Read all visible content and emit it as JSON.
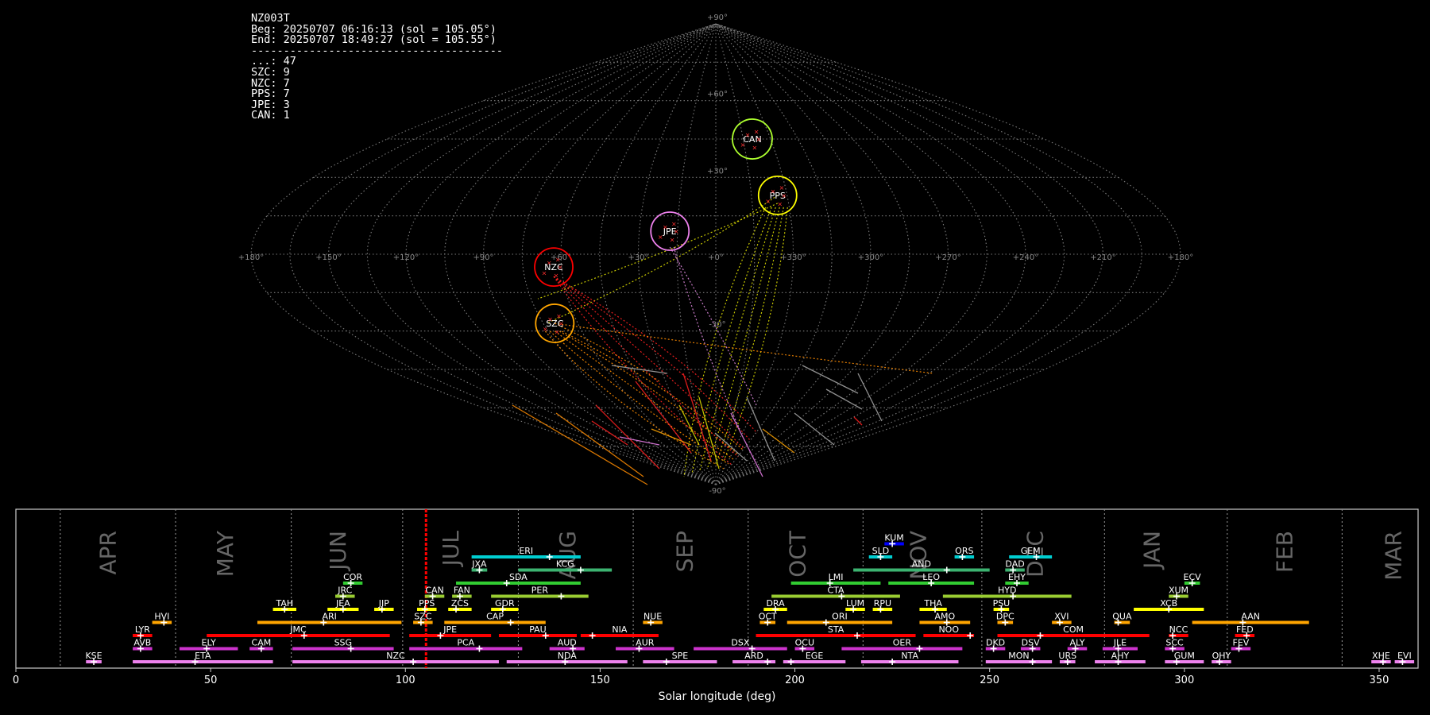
{
  "info": {
    "station": "NZ003T",
    "begin": "Beg: 20250707 06:16:13 (sol = 105.05°)",
    "end": "End: 20250707 18:49:27 (sol = 105.55°)",
    "separator": "---------------------------------------",
    "counts": [
      {
        "code": "...",
        "count": 47
      },
      {
        "code": "SZC",
        "count": 9
      },
      {
        "code": "NZC",
        "count": 7
      },
      {
        "code": "PPS",
        "count": 7
      },
      {
        "code": "JPE",
        "count": 3
      },
      {
        "code": "CAN",
        "count": 1
      }
    ]
  },
  "sky_map": {
    "projection": "sinusoidal",
    "lon_labels": [
      "+180°",
      "+150°",
      "+120°",
      "+90°",
      "+60°",
      "+30°",
      "+0°",
      "+330°",
      "+300°",
      "+270°",
      "+240°",
      "+210°",
      "+180°"
    ],
    "lat_labels": [
      {
        "lat": 90,
        "text": "+90°"
      },
      {
        "lat": 60,
        "text": "+60°"
      },
      {
        "lat": 30,
        "text": "+30°"
      },
      {
        "lat": -30,
        "text": "-30°"
      },
      {
        "lat": -90,
        "text": "-90°"
      }
    ],
    "radiants": [
      {
        "code": "CAN",
        "lon": 20,
        "lat": 45,
        "rx": 25,
        "ry": 25,
        "color": "#adff2f"
      },
      {
        "code": "PPS",
        "lon": 26,
        "lat": 23,
        "rx": 24,
        "ry": 24,
        "color": "#ffff00"
      },
      {
        "code": "JPE",
        "lon": -18,
        "lat": 9,
        "rx": 24,
        "ry": 24,
        "color": "#ee82ee"
      },
      {
        "code": "NZC",
        "lon": -63,
        "lat": -5,
        "rx": 24,
        "ry": 24,
        "color": "#ff0000"
      },
      {
        "code": "SZC",
        "lon": -70,
        "lat": -27,
        "rx": 24,
        "ry": 24,
        "color": "#ffa500"
      }
    ]
  },
  "chart_data": {
    "type": "timeline",
    "xlabel": "Solar longitude (deg)",
    "xlim": [
      0,
      360
    ],
    "xticks": [
      0,
      50,
      100,
      150,
      200,
      250,
      300,
      350
    ],
    "current_sol": 105.3,
    "months": [
      {
        "name": "APR",
        "start": 11.4,
        "label": 24
      },
      {
        "name": "MAY",
        "start": 41,
        "label": 54
      },
      {
        "name": "JUN",
        "start": 70.7,
        "label": 83
      },
      {
        "name": "JUL",
        "start": 99.3,
        "label": 112
      },
      {
        "name": "AUG",
        "start": 129,
        "label": 142
      },
      {
        "name": "SEP",
        "start": 158.5,
        "label": 172
      },
      {
        "name": "OCT",
        "start": 188,
        "label": 201
      },
      {
        "name": "NOV",
        "start": 217.5,
        "label": 232
      },
      {
        "name": "DEC",
        "start": 248,
        "label": 262
      },
      {
        "name": "JAN",
        "start": 279.5,
        "label": 292
      },
      {
        "name": "FEB",
        "start": 311,
        "label": 326
      },
      {
        "name": "MAR",
        "start": 340.5,
        "label": 354
      }
    ],
    "showers": [
      {
        "code": "KUM",
        "start": 223,
        "end": 228,
        "peak": 225,
        "row": 9,
        "color": "#0000ff"
      },
      {
        "code": "ERI",
        "start": 117,
        "end": 145,
        "peak": 137,
        "row": 8,
        "color": "#00ced1"
      },
      {
        "code": "SLD",
        "start": 219,
        "end": 225,
        "peak": 222,
        "row": 8,
        "color": "#00ced1"
      },
      {
        "code": "ORS",
        "start": 241,
        "end": 246,
        "peak": 243,
        "row": 8,
        "color": "#00ced1"
      },
      {
        "code": "GEM",
        "start": 255,
        "end": 266,
        "peak": 262,
        "row": 8,
        "color": "#00ced1"
      },
      {
        "code": "JXA",
        "start": 117,
        "end": 121,
        "peak": 119,
        "row": 7,
        "color": "#3cb371"
      },
      {
        "code": "KCG",
        "start": 129,
        "end": 153,
        "peak": 145,
        "row": 7,
        "color": "#3cb371"
      },
      {
        "code": "AND",
        "start": 215,
        "end": 250,
        "peak": 239,
        "row": 7,
        "color": "#3cb371"
      },
      {
        "code": "DAD",
        "start": 254,
        "end": 259,
        "peak": 256,
        "row": 7,
        "color": "#3cb371"
      },
      {
        "code": "COR",
        "start": 84,
        "end": 89,
        "peak": 86,
        "row": 6,
        "color": "#32cd32"
      },
      {
        "code": "SDA",
        "start": 113,
        "end": 145,
        "peak": 126,
        "row": 6,
        "color": "#32cd32"
      },
      {
        "code": "LMI",
        "start": 199,
        "end": 222,
        "peak": 209,
        "row": 6,
        "color": "#32cd32"
      },
      {
        "code": "LEO",
        "start": 224,
        "end": 246,
        "peak": 235,
        "row": 6,
        "color": "#32cd32"
      },
      {
        "code": "EHY",
        "start": 254,
        "end": 260,
        "peak": 257,
        "row": 6,
        "color": "#32cd32"
      },
      {
        "code": "ECV",
        "start": 300,
        "end": 304,
        "peak": 302,
        "row": 6,
        "color": "#32cd32"
      },
      {
        "code": "JRC",
        "start": 82,
        "end": 87,
        "peak": 84,
        "row": 5,
        "color": "#9acd32"
      },
      {
        "code": "CAN",
        "start": 105,
        "end": 110,
        "peak": 107,
        "row": 5,
        "color": "#9acd32"
      },
      {
        "code": "FAN",
        "start": 112,
        "end": 117,
        "peak": 114,
        "row": 5,
        "color": "#9acd32"
      },
      {
        "code": "PER",
        "start": 122,
        "end": 147,
        "peak": 140,
        "row": 5,
        "color": "#9acd32"
      },
      {
        "code": "CTA",
        "start": 194,
        "end": 227,
        "peak": 212,
        "row": 5,
        "color": "#9acd32"
      },
      {
        "code": "HYD",
        "start": 238,
        "end": 271,
        "peak": 256,
        "row": 5,
        "color": "#9acd32"
      },
      {
        "code": "XUM",
        "start": 296,
        "end": 301,
        "peak": 298,
        "row": 5,
        "color": "#9acd32"
      },
      {
        "code": "TAH",
        "start": 66,
        "end": 72,
        "peak": 69,
        "row": 4,
        "color": "#ffff00"
      },
      {
        "code": "JEA",
        "start": 80,
        "end": 88,
        "peak": 84,
        "row": 4,
        "color": "#ffff00"
      },
      {
        "code": "JIP",
        "start": 92,
        "end": 97,
        "peak": 94,
        "row": 4,
        "color": "#ffff00"
      },
      {
        "code": "PPS",
        "start": 103,
        "end": 108,
        "peak": 105,
        "row": 4,
        "color": "#ffff00"
      },
      {
        "code": "ZCS",
        "start": 111,
        "end": 117,
        "peak": 113,
        "row": 4,
        "color": "#ffff00"
      },
      {
        "code": "GDR",
        "start": 122,
        "end": 129,
        "peak": 125,
        "row": 4,
        "color": "#ffff00"
      },
      {
        "code": "DRA",
        "start": 192,
        "end": 198,
        "peak": 195,
        "row": 4,
        "color": "#ffff00"
      },
      {
        "code": "LUM",
        "start": 213,
        "end": 218,
        "peak": 215,
        "row": 4,
        "color": "#ffff00"
      },
      {
        "code": "RPU",
        "start": 220,
        "end": 225,
        "peak": 222,
        "row": 4,
        "color": "#ffff00"
      },
      {
        "code": "THA",
        "start": 232,
        "end": 239,
        "peak": 236,
        "row": 4,
        "color": "#ffff00"
      },
      {
        "code": "PSU",
        "start": 251,
        "end": 255,
        "peak": 253,
        "row": 4,
        "color": "#ffff00"
      },
      {
        "code": "XCB",
        "start": 287,
        "end": 305,
        "peak": 296,
        "row": 4,
        "color": "#ffff00"
      },
      {
        "code": "HVI",
        "start": 35,
        "end": 40,
        "peak": 38,
        "row": 3,
        "color": "#ffa500"
      },
      {
        "code": "ARI",
        "start": 62,
        "end": 99,
        "peak": 79,
        "row": 3,
        "color": "#ffa500"
      },
      {
        "code": "SZC",
        "start": 102,
        "end": 107,
        "peak": 104,
        "row": 3,
        "color": "#ffa500"
      },
      {
        "code": "CAP",
        "start": 110,
        "end": 136,
        "peak": 127,
        "row": 3,
        "color": "#ffa500"
      },
      {
        "code": "NUE",
        "start": 161,
        "end": 166,
        "peak": 163,
        "row": 3,
        "color": "#ffa500"
      },
      {
        "code": "OCT",
        "start": 191,
        "end": 195,
        "peak": 193,
        "row": 3,
        "color": "#ffa500"
      },
      {
        "code": "ORI",
        "start": 198,
        "end": 225,
        "peak": 208,
        "row": 3,
        "color": "#ffa500"
      },
      {
        "code": "AMO",
        "start": 232,
        "end": 245,
        "peak": 239,
        "row": 3,
        "color": "#ffa500"
      },
      {
        "code": "DPC",
        "start": 252,
        "end": 256,
        "peak": 254,
        "row": 3,
        "color": "#ffa500"
      },
      {
        "code": "XVI",
        "start": 266,
        "end": 271,
        "peak": 268,
        "row": 3,
        "color": "#ffa500"
      },
      {
        "code": "QUA",
        "start": 282,
        "end": 286,
        "peak": 283,
        "row": 3,
        "color": "#ffa500"
      },
      {
        "code": "AAN",
        "start": 302,
        "end": 332,
        "peak": 315,
        "row": 3,
        "color": "#ffa500"
      },
      {
        "code": "LYR",
        "start": 30,
        "end": 35,
        "peak": 32,
        "row": 2,
        "color": "#ff0000"
      },
      {
        "code": "JMC",
        "start": 49,
        "end": 96,
        "peak": 74,
        "row": 2,
        "color": "#ff0000"
      },
      {
        "code": "JPE",
        "start": 101,
        "end": 122,
        "peak": 109,
        "row": 2,
        "color": "#ff0000"
      },
      {
        "code": "PAU",
        "start": 124,
        "end": 144,
        "peak": 136,
        "row": 2,
        "color": "#ff0000"
      },
      {
        "code": "NIA",
        "start": 145,
        "end": 165,
        "peak": 148,
        "row": 2,
        "color": "#ff0000"
      },
      {
        "code": "STA",
        "start": 190,
        "end": 231,
        "peak": 216,
        "row": 2,
        "color": "#ff0000"
      },
      {
        "code": "NOO",
        "start": 233,
        "end": 246,
        "peak": 245,
        "row": 2,
        "color": "#ff0000"
      },
      {
        "code": "COM",
        "start": 252,
        "end": 291,
        "peak": 263,
        "row": 2,
        "color": "#ff0000"
      },
      {
        "code": "NCC",
        "start": 296,
        "end": 301,
        "peak": 297,
        "row": 2,
        "color": "#ff0000"
      },
      {
        "code": "FED",
        "start": 313,
        "end": 318,
        "peak": 316,
        "row": 2,
        "color": "#ff0000"
      },
      {
        "code": "AVB",
        "start": 30,
        "end": 35,
        "peak": 32,
        "row": 1,
        "color": "#cc33cc"
      },
      {
        "code": "ELY",
        "start": 42,
        "end": 57,
        "peak": 49,
        "row": 1,
        "color": "#cc33cc"
      },
      {
        "code": "CAM",
        "start": 60,
        "end": 66,
        "peak": 63,
        "row": 1,
        "color": "#cc33cc"
      },
      {
        "code": "SSG",
        "start": 71,
        "end": 97,
        "peak": 86,
        "row": 1,
        "color": "#cc33cc"
      },
      {
        "code": "PCA",
        "start": 101,
        "end": 130,
        "peak": 119,
        "row": 1,
        "color": "#cc33cc"
      },
      {
        "code": "AUD",
        "start": 137,
        "end": 146,
        "peak": 143,
        "row": 1,
        "color": "#cc33cc"
      },
      {
        "code": "AUR",
        "start": 154,
        "end": 169,
        "peak": 160,
        "row": 1,
        "color": "#cc33cc"
      },
      {
        "code": "DSX",
        "start": 174,
        "end": 198,
        "peak": 189,
        "row": 1,
        "color": "#cc33cc"
      },
      {
        "code": "OCU",
        "start": 200,
        "end": 205,
        "peak": 202,
        "row": 1,
        "color": "#cc33cc"
      },
      {
        "code": "OER",
        "start": 212,
        "end": 243,
        "peak": 232,
        "row": 1,
        "color": "#cc33cc"
      },
      {
        "code": "DKD",
        "start": 249,
        "end": 254,
        "peak": 251,
        "row": 1,
        "color": "#cc33cc"
      },
      {
        "code": "DSV",
        "start": 258,
        "end": 263,
        "peak": 261,
        "row": 1,
        "color": "#cc33cc"
      },
      {
        "code": "ALY",
        "start": 270,
        "end": 275,
        "peak": 272,
        "row": 1,
        "color": "#cc33cc"
      },
      {
        "code": "JLE",
        "start": 279,
        "end": 288,
        "peak": 283,
        "row": 1,
        "color": "#cc33cc"
      },
      {
        "code": "SCC",
        "start": 295,
        "end": 300,
        "peak": 297,
        "row": 1,
        "color": "#cc33cc"
      },
      {
        "code": "FEV",
        "start": 312,
        "end": 317,
        "peak": 314,
        "row": 1,
        "color": "#cc33cc"
      },
      {
        "code": "KSE",
        "start": 18,
        "end": 22,
        "peak": 20,
        "row": 0,
        "color": "#ee82ee"
      },
      {
        "code": "ETA",
        "start": 30,
        "end": 66,
        "peak": 46,
        "row": 0,
        "color": "#ee82ee"
      },
      {
        "code": "NZC",
        "start": 71,
        "end": 124,
        "peak": 102,
        "row": 0,
        "color": "#ee82ee"
      },
      {
        "code": "NDA",
        "start": 126,
        "end": 157,
        "peak": 141,
        "row": 0,
        "color": "#ee82ee"
      },
      {
        "code": "SPE",
        "start": 161,
        "end": 180,
        "peak": 167,
        "row": 0,
        "color": "#ee82ee"
      },
      {
        "code": "ARD",
        "start": 184,
        "end": 195,
        "peak": 193,
        "row": 0,
        "color": "#ee82ee"
      },
      {
        "code": "EGE",
        "start": 197,
        "end": 213,
        "peak": 199,
        "row": 0,
        "color": "#ee82ee"
      },
      {
        "code": "NTA",
        "start": 217,
        "end": 242,
        "peak": 225,
        "row": 0,
        "color": "#ee82ee"
      },
      {
        "code": "MON",
        "start": 249,
        "end": 266,
        "peak": 261,
        "row": 0,
        "color": "#ee82ee"
      },
      {
        "code": "URS",
        "start": 268,
        "end": 272,
        "peak": 270,
        "row": 0,
        "color": "#ee82ee"
      },
      {
        "code": "AHY",
        "start": 277,
        "end": 290,
        "peak": 283,
        "row": 0,
        "color": "#ee82ee"
      },
      {
        "code": "GUM",
        "start": 295,
        "end": 305,
        "peak": 298,
        "row": 0,
        "color": "#ee82ee"
      },
      {
        "code": "OHY",
        "start": 307,
        "end": 312,
        "peak": 309,
        "row": 0,
        "color": "#ee82ee"
      },
      {
        "code": "XHE",
        "start": 348,
        "end": 353,
        "peak": 351,
        "row": 0,
        "color": "#ee82ee"
      },
      {
        "code": "EVI",
        "start": 354,
        "end": 359,
        "peak": 356,
        "row": 0,
        "color": "#ee82ee"
      }
    ]
  }
}
